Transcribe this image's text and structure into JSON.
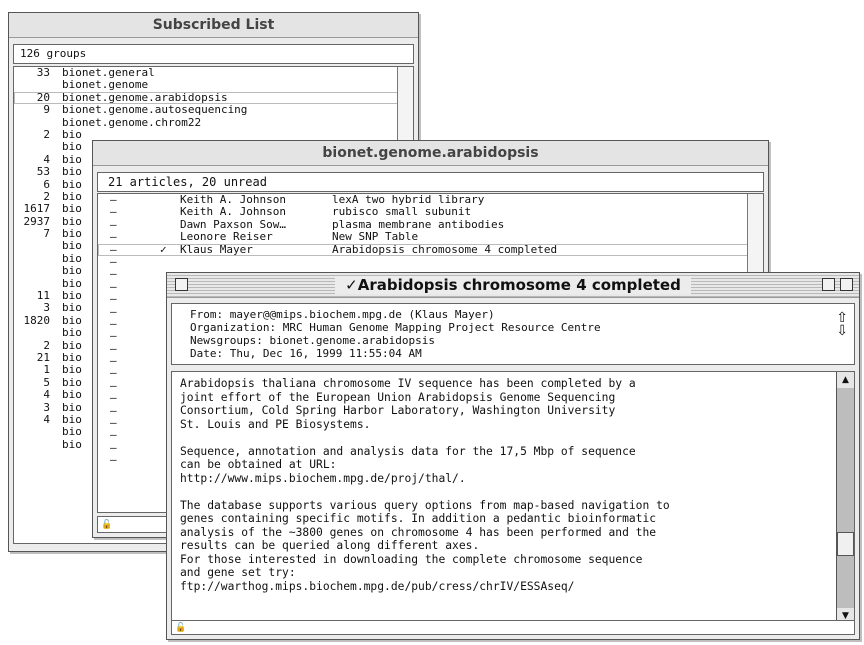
{
  "subscribed": {
    "title": "Subscribed List",
    "count": "126 groups",
    "rows": [
      {
        "count": "33",
        "name": "bionet.general"
      },
      {
        "count": "",
        "name": "bionet.genome"
      },
      {
        "count": "20",
        "name": "bionet.genome.arabidopsis"
      },
      {
        "count": "9",
        "name": "bionet.genome.autosequencing"
      },
      {
        "count": "",
        "name": "bionet.genome.chrom22"
      },
      {
        "count": "2",
        "name": "bio"
      },
      {
        "count": "",
        "name": "bio"
      },
      {
        "count": "4",
        "name": "bio"
      },
      {
        "count": "53",
        "name": "bio"
      },
      {
        "count": "6",
        "name": "bio"
      },
      {
        "count": "2",
        "name": "bio"
      },
      {
        "count": "1617",
        "name": "bio"
      },
      {
        "count": "2937",
        "name": "bio"
      },
      {
        "count": "7",
        "name": "bio"
      },
      {
        "count": "",
        "name": "bio"
      },
      {
        "count": "",
        "name": "bio"
      },
      {
        "count": "",
        "name": "bio"
      },
      {
        "count": "",
        "name": "bio"
      },
      {
        "count": "11",
        "name": "bio"
      },
      {
        "count": "3",
        "name": "bio"
      },
      {
        "count": "1820",
        "name": "bio"
      },
      {
        "count": "",
        "name": "bio"
      },
      {
        "count": "2",
        "name": "bio"
      },
      {
        "count": "21",
        "name": "bio"
      },
      {
        "count": "1",
        "name": "bio"
      },
      {
        "count": "5",
        "name": "bio"
      },
      {
        "count": "4",
        "name": "bio"
      },
      {
        "count": "3",
        "name": "bio"
      },
      {
        "count": "4",
        "name": "bio"
      },
      {
        "count": "",
        "name": "bio"
      },
      {
        "count": "",
        "name": "bio"
      }
    ]
  },
  "group": {
    "title": "bionet.genome.arabidopsis",
    "count": "21 articles, 20 unread",
    "rows": [
      {
        "dash": "–",
        "check": "",
        "author": "Keith A. Johnson",
        "subject": "lexA two hybrid library"
      },
      {
        "dash": "–",
        "check": "",
        "author": "Keith A. Johnson",
        "subject": "rubisco small subunit"
      },
      {
        "dash": "–",
        "check": "",
        "author": "Dawn Paxson Sow…",
        "subject": "plasma membrane antibodies"
      },
      {
        "dash": "–",
        "check": "",
        "author": "Leonore Reiser",
        "subject": "New SNP Table"
      },
      {
        "dash": "–",
        "check": "✓",
        "author": "Klaus Mayer",
        "subject": "Arabidopsis chromosome 4 completed"
      },
      {
        "dash": "–",
        "check": "",
        "author": "",
        "subject": ""
      },
      {
        "dash": "–",
        "check": "",
        "author": "",
        "subject": ""
      },
      {
        "dash": "–",
        "check": "",
        "author": "",
        "subject": ""
      },
      {
        "dash": "–",
        "check": "",
        "author": "",
        "subject": ""
      },
      {
        "dash": "–",
        "check": "",
        "author": "",
        "subject": ""
      },
      {
        "dash": "–",
        "check": "",
        "author": "",
        "subject": ""
      },
      {
        "dash": "–",
        "check": "",
        "author": "",
        "subject": ""
      },
      {
        "dash": "–",
        "check": "",
        "author": "",
        "subject": ""
      },
      {
        "dash": "–",
        "check": "",
        "author": "",
        "subject": ""
      },
      {
        "dash": "–",
        "check": "",
        "author": "",
        "subject": ""
      },
      {
        "dash": "–",
        "check": "",
        "author": "",
        "subject": ""
      },
      {
        "dash": "–",
        "check": "",
        "author": "",
        "subject": ""
      },
      {
        "dash": "–",
        "check": "",
        "author": "",
        "subject": ""
      },
      {
        "dash": "–",
        "check": "",
        "author": "",
        "subject": ""
      },
      {
        "dash": "–",
        "check": "",
        "author": "",
        "subject": ""
      },
      {
        "dash": "–",
        "check": "",
        "author": "",
        "subject": ""
      },
      {
        "dash": "–",
        "check": "",
        "author": "",
        "subject": ""
      }
    ]
  },
  "message": {
    "title": "✓Arabidopsis chromosome 4 completed",
    "from": "From: mayer@@mips.biochem.mpg.de (Klaus Mayer)",
    "organization": "Organization: MRC Human Genome Mapping Project Resource Centre",
    "newsgroups": "Newsgroups: bionet.genome.arabidopsis",
    "date": "Date: Thu, Dec 16, 1999 11:55:04 AM",
    "body_lines": [
      "Arabidopsis thaliana chromosome IV sequence has been completed by a",
      "joint effort of the European Union Arabidopsis Genome Sequencing",
      "Consortium, Cold Spring Harbor Laboratory, Washington University",
      "St. Louis and PE Biosystems.",
      "",
      "Sequence, annotation and analysis data for the 17,5 Mbp of sequence",
      "can be obtained at URL:",
      "http://www.mips.biochem.mpg.de/proj/thal/.",
      "",
      "The database supports various query options from map-based navigation to",
      "genes containing specific motifs. In addition a pedantic bioinformatic",
      "analysis of the ~3800 genes on chromosome 4 has been performed and the",
      "results can be queried along different axes.",
      "For those interested in downloading the complete chromosome sequence",
      "and gene set try:",
      "ftp://warthog.mips.biochem.mpg.de/pub/cress/chrIV/ESSAseq/"
    ]
  },
  "icons": {
    "lock": "lock-icon",
    "up_down": "up-down-arrows-icon"
  }
}
